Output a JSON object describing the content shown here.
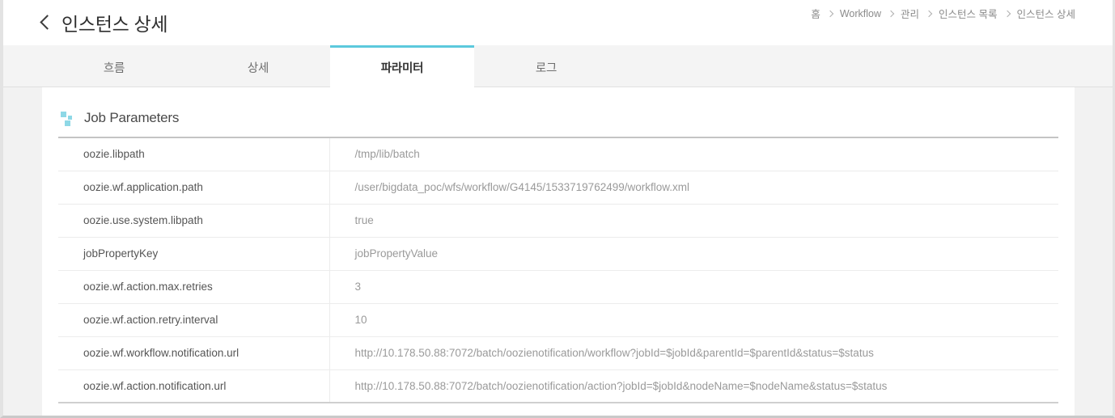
{
  "header": {
    "back_icon": "chevron-left-icon",
    "title": "인스턴스 상세"
  },
  "breadcrumb": {
    "items": [
      {
        "label": "홈"
      },
      {
        "label": "Workflow"
      },
      {
        "label": "관리"
      },
      {
        "label": "인스턴스 목록"
      },
      {
        "label": "인스턴스 상세"
      }
    ],
    "separator": "chevron-right-icon"
  },
  "tabs": {
    "items": [
      {
        "label": "흐름",
        "active": false
      },
      {
        "label": "상세",
        "active": false
      },
      {
        "label": "파라미터",
        "active": true
      },
      {
        "label": "로그",
        "active": false
      }
    ],
    "active_color": "#5cc9dd"
  },
  "section": {
    "icon": "blocks-icon",
    "icon_color": "#8ed8e6",
    "title": "Job Parameters"
  },
  "parameters": {
    "rows": [
      {
        "key": "oozie.libpath",
        "value": "/tmp/lib/batch"
      },
      {
        "key": "oozie.wf.application.path",
        "value": "/user/bigdata_poc/wfs/workflow/G4145/1533719762499/workflow.xml"
      },
      {
        "key": "oozie.use.system.libpath",
        "value": "true"
      },
      {
        "key": "jobPropertyKey",
        "value": "jobPropertyValue"
      },
      {
        "key": "oozie.wf.action.max.retries",
        "value": "3"
      },
      {
        "key": "oozie.wf.action.retry.interval",
        "value": "10"
      },
      {
        "key": "oozie.wf.workflow.notification.url",
        "value": "http://10.178.50.88:7072/batch/oozienotification/workflow?jobId=$jobId&parentId=$parentId&status=$status"
      },
      {
        "key": "oozie.wf.action.notification.url",
        "value": "http://10.178.50.88:7072/batch/oozienotification/action?jobId=$jobId&nodeName=$nodeName&status=$status"
      }
    ]
  }
}
